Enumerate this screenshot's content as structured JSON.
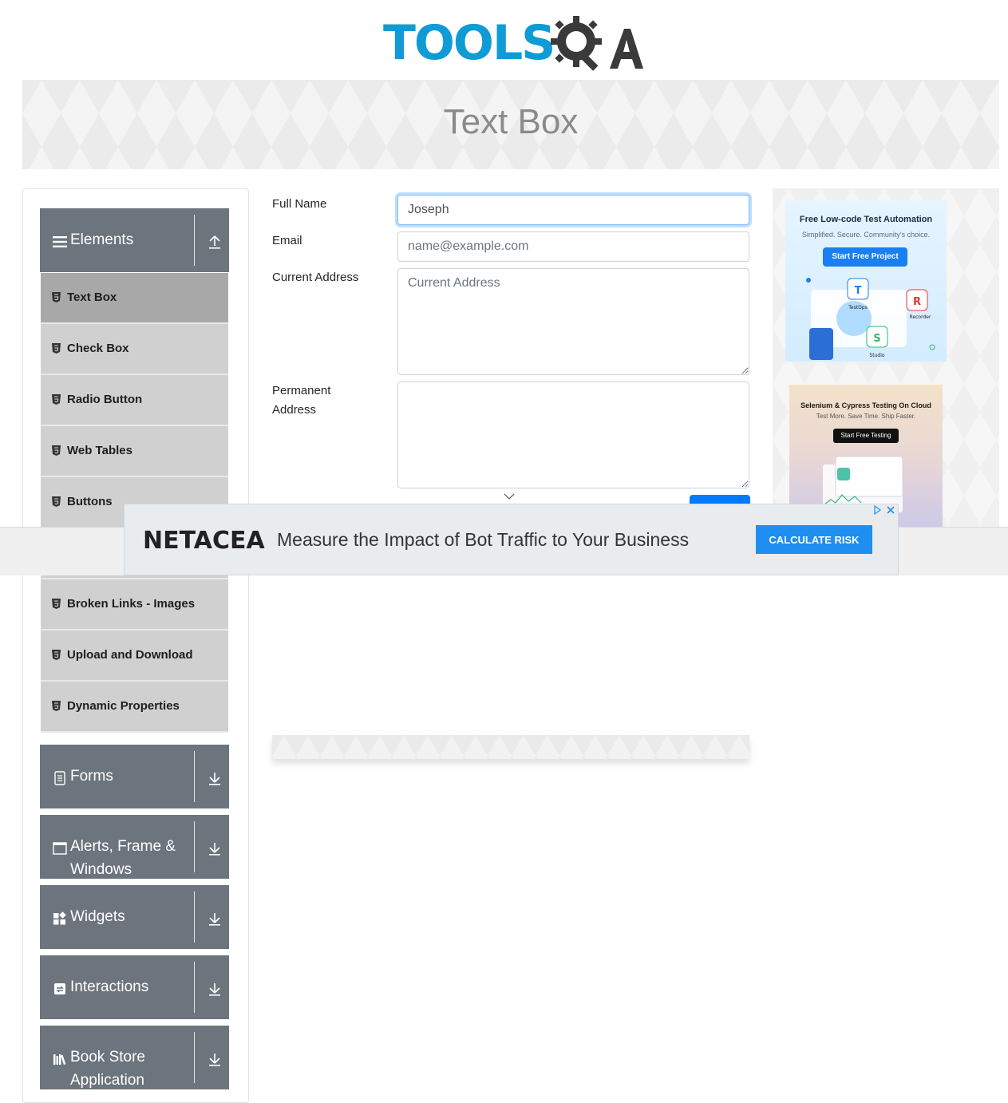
{
  "brand": {
    "logo_text": "TOOLS",
    "logo_qa": "QA"
  },
  "banner": {
    "title": "Text Box"
  },
  "sidebar": {
    "groups": [
      {
        "label": "Elements",
        "icon": "hamburger-icon",
        "expanded": true
      },
      {
        "label": "Forms",
        "icon": "form-icon",
        "expanded": false
      },
      {
        "label": "Alerts, Frame & Windows",
        "icon": "window-icon",
        "expanded": false
      },
      {
        "label": "Widgets",
        "icon": "widgets-icon",
        "expanded": false
      },
      {
        "label": "Interactions",
        "icon": "interactions-icon",
        "expanded": false
      },
      {
        "label": "Book Store Application",
        "icon": "book-icon",
        "expanded": false
      }
    ],
    "items": [
      {
        "label": "Text Box",
        "active": true
      },
      {
        "label": "Check Box"
      },
      {
        "label": "Radio Button"
      },
      {
        "label": "Web Tables"
      },
      {
        "label": "Buttons"
      },
      {
        "label": "Broken Links - Images"
      },
      {
        "label": "Upload and Download"
      },
      {
        "label": "Dynamic Properties"
      }
    ]
  },
  "form": {
    "full_name_label": "Full Name",
    "full_name_value": "Joseph",
    "email_label": "Email",
    "email_placeholder": "name@example.com",
    "current_address_label": "Current Address",
    "current_address_placeholder": "Current Address",
    "permanent_address_label": "Permanent Address"
  },
  "ads": {
    "ad1": {
      "title": "Free Low-code Test Automation",
      "subtitle": "Simplified. Secure. Community's choice.",
      "cta": "Start Free Project",
      "labels": [
        "TestOps",
        "Recorder",
        "Studio"
      ]
    },
    "ad2": {
      "title": "Selenium & Cypress Testing On Cloud",
      "subtitle": "Test More. Save Time. Ship Faster.",
      "cta": "Start Free Testing"
    },
    "bottom": {
      "brand": "NETACEA",
      "text": "Measure the Impact of Bot Traffic to Your Business",
      "cta": "CALCULATE RISK"
    }
  },
  "colors": {
    "brand_blue": "#0e9bd6",
    "sidebar_header": "#6c757d",
    "menu_item": "#d0d0d0",
    "menu_item_active": "#a8a8a8",
    "cta_blue": "#1e8ef0"
  }
}
